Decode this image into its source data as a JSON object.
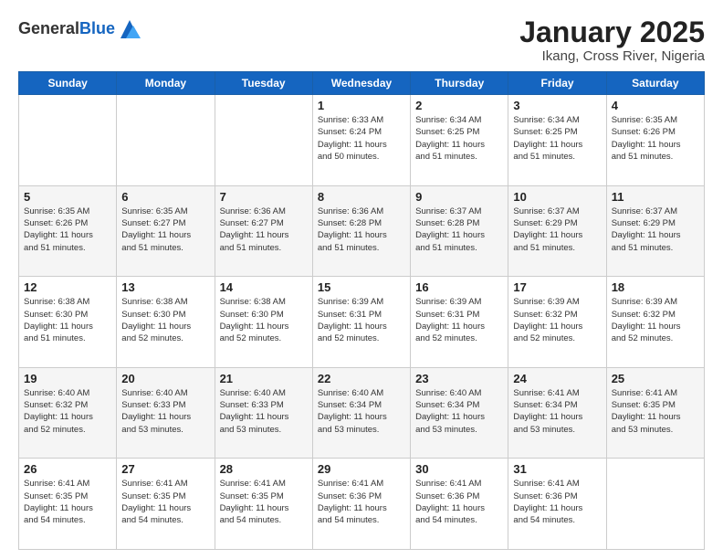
{
  "logo": {
    "general": "General",
    "blue": "Blue"
  },
  "header": {
    "title": "January 2025",
    "subtitle": "Ikang, Cross River, Nigeria"
  },
  "weekdays": [
    "Sunday",
    "Monday",
    "Tuesday",
    "Wednesday",
    "Thursday",
    "Friday",
    "Saturday"
  ],
  "weeks": [
    [
      {
        "day": "",
        "info": ""
      },
      {
        "day": "",
        "info": ""
      },
      {
        "day": "",
        "info": ""
      },
      {
        "day": "1",
        "info": "Sunrise: 6:33 AM\nSunset: 6:24 PM\nDaylight: 11 hours\nand 50 minutes."
      },
      {
        "day": "2",
        "info": "Sunrise: 6:34 AM\nSunset: 6:25 PM\nDaylight: 11 hours\nand 51 minutes."
      },
      {
        "day": "3",
        "info": "Sunrise: 6:34 AM\nSunset: 6:25 PM\nDaylight: 11 hours\nand 51 minutes."
      },
      {
        "day": "4",
        "info": "Sunrise: 6:35 AM\nSunset: 6:26 PM\nDaylight: 11 hours\nand 51 minutes."
      }
    ],
    [
      {
        "day": "5",
        "info": "Sunrise: 6:35 AM\nSunset: 6:26 PM\nDaylight: 11 hours\nand 51 minutes."
      },
      {
        "day": "6",
        "info": "Sunrise: 6:35 AM\nSunset: 6:27 PM\nDaylight: 11 hours\nand 51 minutes."
      },
      {
        "day": "7",
        "info": "Sunrise: 6:36 AM\nSunset: 6:27 PM\nDaylight: 11 hours\nand 51 minutes."
      },
      {
        "day": "8",
        "info": "Sunrise: 6:36 AM\nSunset: 6:28 PM\nDaylight: 11 hours\nand 51 minutes."
      },
      {
        "day": "9",
        "info": "Sunrise: 6:37 AM\nSunset: 6:28 PM\nDaylight: 11 hours\nand 51 minutes."
      },
      {
        "day": "10",
        "info": "Sunrise: 6:37 AM\nSunset: 6:29 PM\nDaylight: 11 hours\nand 51 minutes."
      },
      {
        "day": "11",
        "info": "Sunrise: 6:37 AM\nSunset: 6:29 PM\nDaylight: 11 hours\nand 51 minutes."
      }
    ],
    [
      {
        "day": "12",
        "info": "Sunrise: 6:38 AM\nSunset: 6:30 PM\nDaylight: 11 hours\nand 51 minutes."
      },
      {
        "day": "13",
        "info": "Sunrise: 6:38 AM\nSunset: 6:30 PM\nDaylight: 11 hours\nand 52 minutes."
      },
      {
        "day": "14",
        "info": "Sunrise: 6:38 AM\nSunset: 6:30 PM\nDaylight: 11 hours\nand 52 minutes."
      },
      {
        "day": "15",
        "info": "Sunrise: 6:39 AM\nSunset: 6:31 PM\nDaylight: 11 hours\nand 52 minutes."
      },
      {
        "day": "16",
        "info": "Sunrise: 6:39 AM\nSunset: 6:31 PM\nDaylight: 11 hours\nand 52 minutes."
      },
      {
        "day": "17",
        "info": "Sunrise: 6:39 AM\nSunset: 6:32 PM\nDaylight: 11 hours\nand 52 minutes."
      },
      {
        "day": "18",
        "info": "Sunrise: 6:39 AM\nSunset: 6:32 PM\nDaylight: 11 hours\nand 52 minutes."
      }
    ],
    [
      {
        "day": "19",
        "info": "Sunrise: 6:40 AM\nSunset: 6:32 PM\nDaylight: 11 hours\nand 52 minutes."
      },
      {
        "day": "20",
        "info": "Sunrise: 6:40 AM\nSunset: 6:33 PM\nDaylight: 11 hours\nand 53 minutes."
      },
      {
        "day": "21",
        "info": "Sunrise: 6:40 AM\nSunset: 6:33 PM\nDaylight: 11 hours\nand 53 minutes."
      },
      {
        "day": "22",
        "info": "Sunrise: 6:40 AM\nSunset: 6:34 PM\nDaylight: 11 hours\nand 53 minutes."
      },
      {
        "day": "23",
        "info": "Sunrise: 6:40 AM\nSunset: 6:34 PM\nDaylight: 11 hours\nand 53 minutes."
      },
      {
        "day": "24",
        "info": "Sunrise: 6:41 AM\nSunset: 6:34 PM\nDaylight: 11 hours\nand 53 minutes."
      },
      {
        "day": "25",
        "info": "Sunrise: 6:41 AM\nSunset: 6:35 PM\nDaylight: 11 hours\nand 53 minutes."
      }
    ],
    [
      {
        "day": "26",
        "info": "Sunrise: 6:41 AM\nSunset: 6:35 PM\nDaylight: 11 hours\nand 54 minutes."
      },
      {
        "day": "27",
        "info": "Sunrise: 6:41 AM\nSunset: 6:35 PM\nDaylight: 11 hours\nand 54 minutes."
      },
      {
        "day": "28",
        "info": "Sunrise: 6:41 AM\nSunset: 6:35 PM\nDaylight: 11 hours\nand 54 minutes."
      },
      {
        "day": "29",
        "info": "Sunrise: 6:41 AM\nSunset: 6:36 PM\nDaylight: 11 hours\nand 54 minutes."
      },
      {
        "day": "30",
        "info": "Sunrise: 6:41 AM\nSunset: 6:36 PM\nDaylight: 11 hours\nand 54 minutes."
      },
      {
        "day": "31",
        "info": "Sunrise: 6:41 AM\nSunset: 6:36 PM\nDaylight: 11 hours\nand 54 minutes."
      },
      {
        "day": "",
        "info": ""
      }
    ]
  ]
}
